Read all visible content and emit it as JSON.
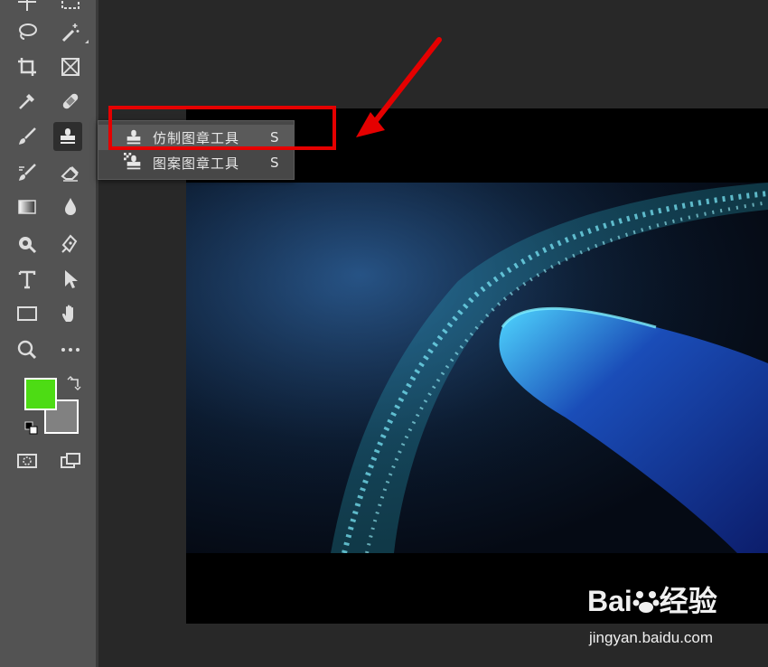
{
  "flyout": {
    "items": [
      {
        "label": "仿制图章工具",
        "shortcut": "S",
        "icon": "clone-stamp-icon"
      },
      {
        "label": "图案图章工具",
        "shortcut": "S",
        "icon": "pattern-stamp-icon"
      }
    ]
  },
  "colors": {
    "foreground": "#4ddc14",
    "background": "#818181",
    "highlight": "#e50000"
  },
  "watermark": {
    "logo_prefix": "Bai",
    "logo_suffix": "经验",
    "url": "jingyan.baidu.com"
  }
}
